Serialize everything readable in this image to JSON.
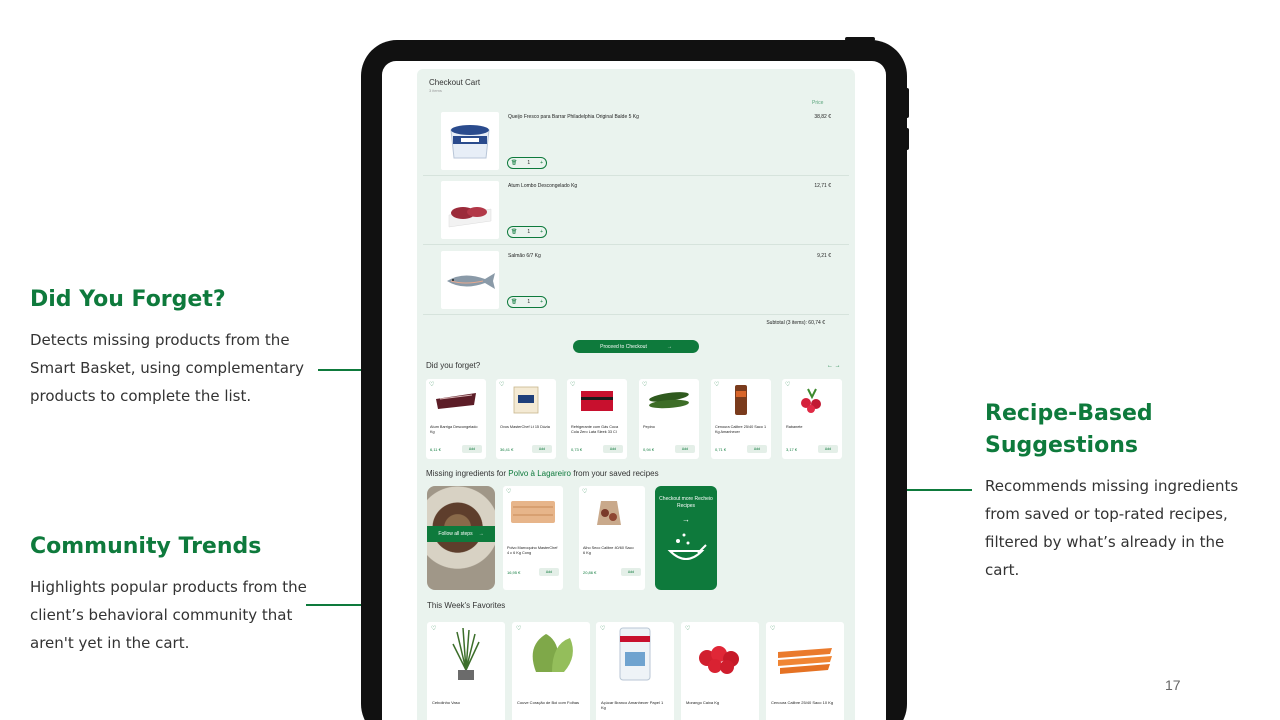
{
  "callouts": {
    "forget": {
      "title": "Did You Forget?",
      "text": "Detects missing products from the Smart Basket, using complementary products to complete the list."
    },
    "community": {
      "title": "Community Trends",
      "text": "Highlights popular products from the client’s behavioral community that aren't yet in the cart."
    },
    "recipe": {
      "title": "Recipe-Based Suggestions",
      "text": "Recommends missing ingredients from saved or top-rated recipes, filtered by what’s already in the cart."
    }
  },
  "page_number": "17",
  "cart": {
    "title": "Checkout Cart",
    "count": "3 items",
    "price_header": "Price",
    "items": [
      {
        "name": "Queijo Fresco para Barrar Philadelphia Original Balde 5 Kg",
        "price": "38,82 €",
        "qty": "1"
      },
      {
        "name": "Atum Lombo Descongelado Kg",
        "price": "12,71 €",
        "qty": "1"
      },
      {
        "name": "Salmão 6/7 Kg",
        "price": "9,21 €",
        "qty": "1"
      }
    ],
    "subtotal": "Subtotal (3 items): 60,74 €",
    "checkout_label": "Proceed to Checkout",
    "checkout_arrow": "→"
  },
  "forget": {
    "title": "Did you forget?",
    "arrows": "← →",
    "products": [
      {
        "name": "Atum Barriga Descongelado Kg",
        "price": "6,11 €",
        "add": "Add"
      },
      {
        "name": "Ovos MasterChef Lt 15 Dúzia",
        "price": "36,41 €",
        "add": "Add"
      },
      {
        "name": "Refrigerante com Gás Coca Cola Zero Lata Sleek 33 Cl",
        "price": "0,73 €",
        "add": "Add"
      },
      {
        "name": "Pepino",
        "price": "0,94 €",
        "add": "Add"
      },
      {
        "name": "Cenoura Calibre 25/40 Saco 1 Kg Amanhecer",
        "price": "0,71 €",
        "add": "Add"
      },
      {
        "name": "Rabanete",
        "price": "3,17 €",
        "add": "Add"
      }
    ]
  },
  "recipes": {
    "title_prefix": "Missing ingredients for",
    "recipe_name": "Polvo à Lagareiro",
    "title_suffix": "from your saved recipes",
    "follow_label": "Follow all steps",
    "follow_arrow": "→",
    "products": [
      {
        "name": "Polvo Marroquino MasterChef 4 c 6 Kg Cong",
        "price": "16,95 €",
        "add": "Add"
      },
      {
        "name": "Alho Seco Calibre 40/60 Saco 6 Kg",
        "price": "20,86 €",
        "add": "Add"
      }
    ],
    "more_label": "Checkout more Recheio Recipes",
    "more_arrow": "→"
  },
  "favorites": {
    "title": "This Week's Favorites",
    "products": [
      {
        "name": "Cebolinho Vaso"
      },
      {
        "name": "Couve Coração de Boi com Folhas"
      },
      {
        "name": "Açúcar Branco Amanhecer Papel 1 Kg"
      },
      {
        "name": "Morango Caixa Kg"
      },
      {
        "name": "Cenoura Calibre 25/40 Saco 10 Kg"
      }
    ]
  },
  "icons": {
    "heart": "♡",
    "trash": "🗑",
    "plus": "+"
  },
  "colors": {
    "brand_green": "#0e7a3c",
    "app_background": "#eaf3ee"
  }
}
